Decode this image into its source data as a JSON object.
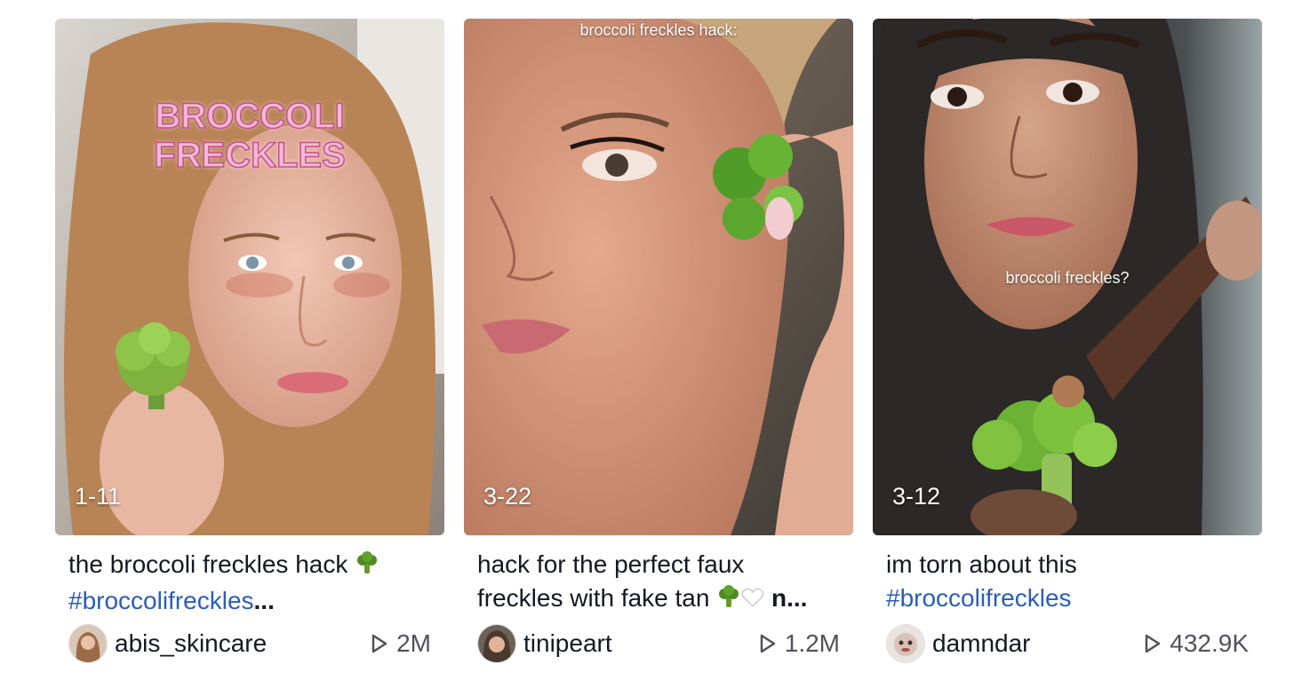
{
  "videos": [
    {
      "date": "1-11",
      "overlay_text_line1": "BROCCOLI",
      "overlay_text_line2": "FRECKLES",
      "caption_text": "the broccoli freckles hack ",
      "caption_tag": "#broccolifreckles",
      "caption_ellipsis": "...",
      "username": "abis_skincare",
      "plays": "2M",
      "icons": [
        "broccoli-emoji-icon",
        "play-icon",
        "avatar"
      ]
    },
    {
      "date": "3-22",
      "overlay_text": "broccoli freckles hack:",
      "caption_line1": "hack for the perfect faux",
      "caption_line2": "freckles with fake tan ",
      "caption_suffix": " n...",
      "username": "tinipeart",
      "plays": "1.2M",
      "icons": [
        "broccoli-emoji-icon",
        "white-heart-emoji-icon",
        "play-icon",
        "avatar"
      ]
    },
    {
      "date": "3-12",
      "overlay_text": "broccoli freckles?",
      "caption_text": "im torn about this",
      "caption_tag": "#broccolifreckles",
      "username": "damndar",
      "plays": "432.9K",
      "icons": [
        "play-icon",
        "avatar"
      ]
    }
  ],
  "colors": {
    "hashtag": "#2b5db9",
    "text": "#161823",
    "overlay_pink": "#f6b8d4"
  }
}
